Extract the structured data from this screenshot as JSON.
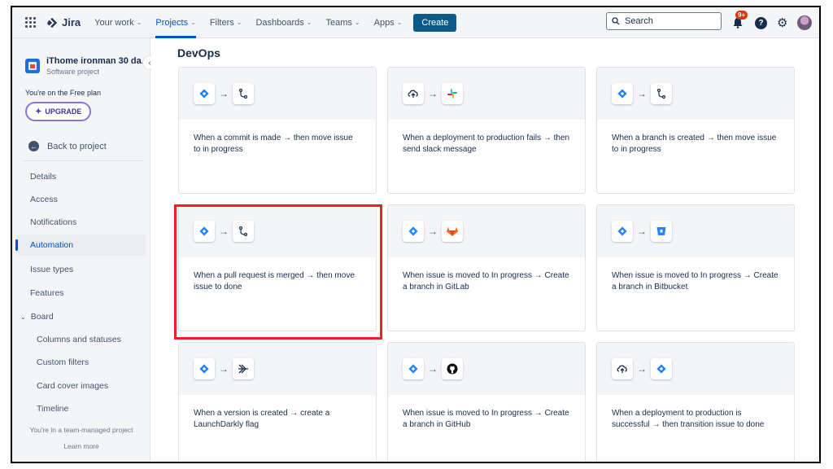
{
  "topnav": {
    "logo": "Jira",
    "items": [
      {
        "label": "Your work",
        "chevron": true
      },
      {
        "label": "Projects",
        "chevron": true
      },
      {
        "label": "Filters",
        "chevron": true
      },
      {
        "label": "Dashboards",
        "chevron": true
      },
      {
        "label": "Teams",
        "chevron": true
      },
      {
        "label": "Apps",
        "chevron": true
      }
    ],
    "active_item": "Projects",
    "create_label": "Create",
    "search_placeholder": "Search",
    "notification_badge": "9+",
    "help_glyph": "?",
    "accent_color": "#0052CC",
    "create_color": "#0C5A8A"
  },
  "sidebar": {
    "project_name": "iThome ironman 30 da...",
    "project_type": "Software project",
    "collapse_glyph": "‹",
    "plan_text": "You're on the Free plan",
    "upgrade_label": "UPGRADE",
    "back_label": "Back to project",
    "items": [
      {
        "label": "Details"
      },
      {
        "label": "Access"
      },
      {
        "label": "Notifications"
      },
      {
        "label": "Automation"
      },
      {
        "label": "Issue types"
      },
      {
        "label": "Features"
      },
      {
        "label": "Board"
      },
      {
        "label": "Columns and statuses"
      },
      {
        "label": "Custom filters"
      },
      {
        "label": "Card cover images"
      },
      {
        "label": "Timeline"
      }
    ],
    "active_item": "Automation",
    "footer_text": "You're in a team-managed project",
    "footer_link": "Learn more"
  },
  "main": {
    "section_title": "DevOps",
    "cards": [
      {
        "from_icon": "jira-diamond-icon",
        "to_icon": "branch-icon",
        "text": "When a commit is made → then move issue to in progress"
      },
      {
        "from_icon": "cloud-upload-icon",
        "to_icon": "slack-icon",
        "text": "When a deployment to production fails → then send slack message"
      },
      {
        "from_icon": "jira-diamond-icon",
        "to_icon": "branch-icon",
        "text": "When a branch is created → then move issue to in progress"
      },
      {
        "from_icon": "jira-diamond-icon",
        "to_icon": "branch-icon",
        "text": "When a pull request is merged → then move issue to done"
      },
      {
        "from_icon": "jira-diamond-icon",
        "to_icon": "gitlab-icon",
        "text": "When issue is moved to In progress → Create a branch in GitLab"
      },
      {
        "from_icon": "jira-diamond-icon",
        "to_icon": "bitbucket-icon",
        "text": "When issue is moved to In progress → Create a branch in Bitbucket"
      },
      {
        "from_icon": "jira-diamond-icon",
        "to_icon": "launchdarkly-icon",
        "text": "When a version is created → create a LaunchDarkly flag"
      },
      {
        "from_icon": "jira-diamond-icon",
        "to_icon": "github-icon",
        "text": "When issue is moved to In progress → Create a branch in GitHub"
      },
      {
        "from_icon": "cloud-upload-icon",
        "to_icon": "jira-diamond-icon",
        "text": "When a deployment to production is successful → then transition issue to done"
      }
    ],
    "highlighted_card": "When a pull request is merged → then move issue to done",
    "arrow_glyph": "→",
    "highlight_color": "#E5252A"
  }
}
